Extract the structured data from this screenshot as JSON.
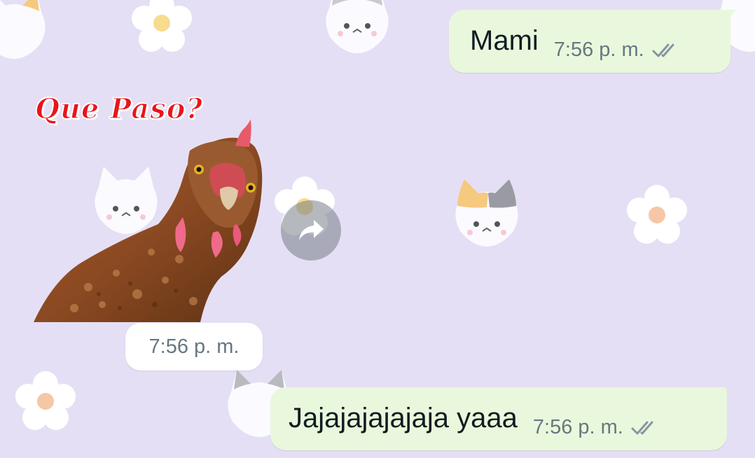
{
  "chat": {
    "messages": [
      {
        "direction": "outgoing",
        "type": "text",
        "text": "Mami",
        "time": "7:56 p. m.",
        "status_icon": "double-check-icon"
      },
      {
        "direction": "incoming",
        "type": "sticker",
        "sticker_caption": "Que Paso?",
        "sticker_icon": "chicken-sticker",
        "time": "7:56 p. m.",
        "forward_icon": "forward-arrow-icon"
      },
      {
        "direction": "outgoing",
        "type": "text",
        "text": "Jajajajajajaja yaaa",
        "time": "7:56 p. m.",
        "status_icon": "double-check-icon"
      }
    ]
  },
  "colors": {
    "wallpaper": "#e5dff5",
    "outgoing_bubble": "#e9f8dc",
    "incoming_time_bubble": "#ffffff",
    "meta_text": "#667781",
    "message_text": "#111b21",
    "sticker_caption": "#e8151b"
  }
}
